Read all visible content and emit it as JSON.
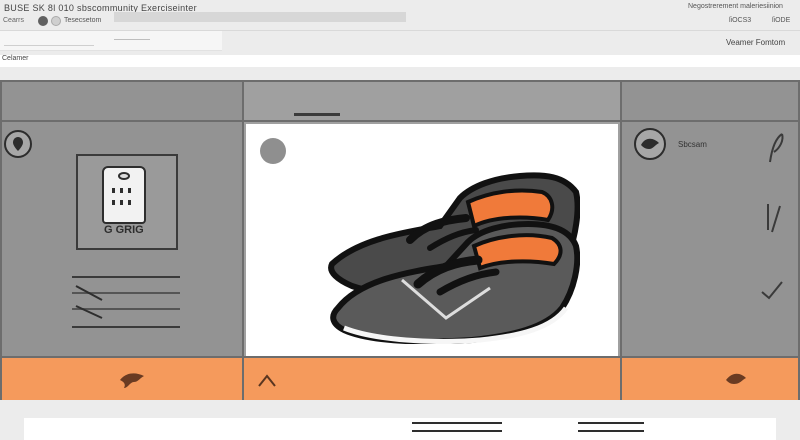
{
  "app": {
    "brand": "BUSE SK 8l 010  sbscommunity Exerciseinter",
    "topbar_tags": "Negostrerement maleriesiinion",
    "field_a": "Cearrs",
    "field_b": "Tesecsetom",
    "right_val_a": "ſiOCS3",
    "right_val_b": "ſiODE",
    "top_right_action": "Veamer Fomtom",
    "section_label": "Celamer"
  },
  "left_panel": {
    "tag_text": "G GRIG"
  },
  "center_panel": {},
  "right_panel": {
    "item_label": "Sbcsam"
  },
  "icons": {
    "left_circle": "pin-icon",
    "right_circle": "brand-icon",
    "feather": "feather-icon",
    "pen": "pen-icon",
    "check": "check-icon",
    "left_footer": "bird-icon",
    "center_footer": "chevron-up-icon",
    "right_footer": "fish-icon"
  },
  "colors": {
    "accent": "#f59a5c",
    "panel": "#939393"
  }
}
